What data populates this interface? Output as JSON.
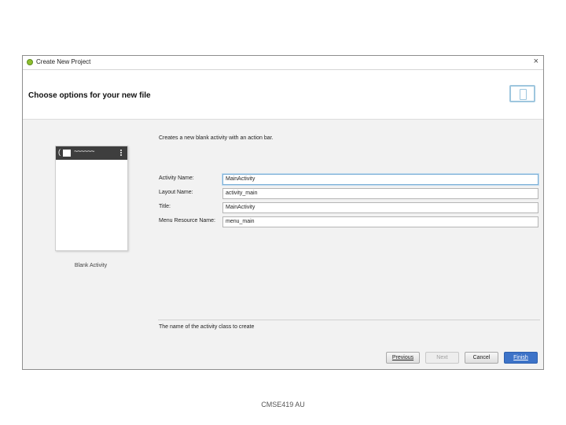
{
  "window": {
    "title": "Create New Project",
    "close_glyph": "×",
    "app_icon": "android-studio-icon"
  },
  "header": {
    "heading": "Choose options for your new file",
    "icon": "device-icon"
  },
  "preview": {
    "label": "Blank Activity",
    "paren": "(",
    "wave": "~~~~~~"
  },
  "description": "Creates a new blank activity with an action bar.",
  "form": {
    "activity_name": {
      "label": "Activity Name:",
      "value": "MainActivity"
    },
    "layout_name": {
      "label": "Layout Name:",
      "value": "activity_main"
    },
    "title": {
      "label": "Title:",
      "value": "MainActivity"
    },
    "menu_resource_name": {
      "label": "Menu Resource Name:",
      "value": "menu_main"
    }
  },
  "help_text": "The name of the activity class to create",
  "buttons": {
    "previous": "Previous",
    "next": "Next",
    "cancel": "Cancel",
    "finish": "Finish"
  },
  "footer": "CMSE419 AU",
  "colors": {
    "accent": "#3d73c8",
    "focus": "#7aaed6",
    "dialog_bg": "#f2f2f2"
  }
}
